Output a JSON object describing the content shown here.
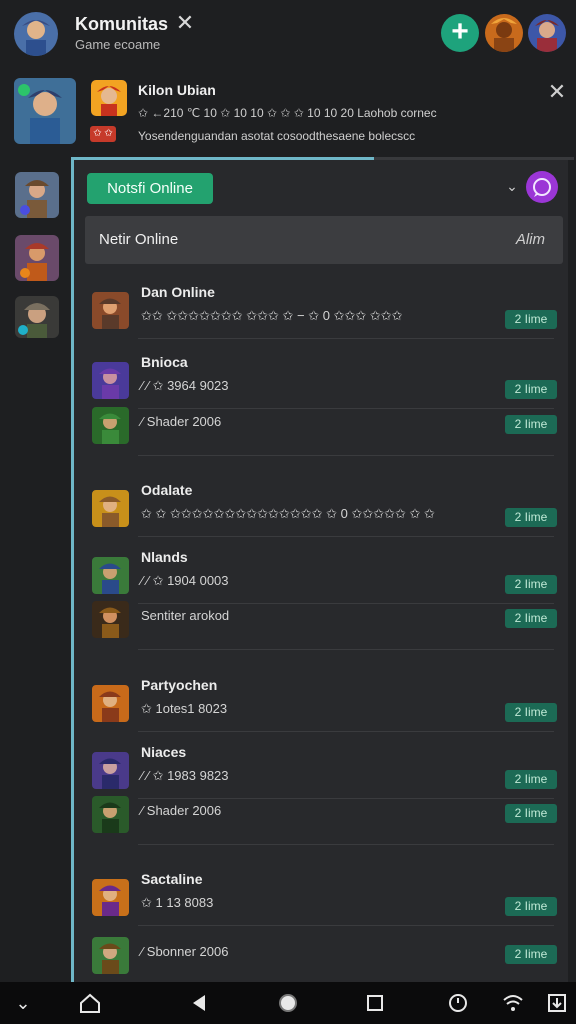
{
  "header": {
    "title": "Komunitas",
    "subtitle": "Game ecoame",
    "close_icon": "close-icon",
    "add_icon": "plus-icon"
  },
  "notification": {
    "title": "Kilon Ubian",
    "line1": "✩ ←210 ℃ 10 ✩ 10 10 ✩ ✩ ✩ 10 10 20 Laohob cornec",
    "line2": "Yosendenguandan asotat cosoodthesaene bolecscc",
    "badge": "✩ ✩"
  },
  "panel": {
    "status_button": "Notsfi Online",
    "subheader_title": "Netir Online",
    "subheader_right": "Alim",
    "rows": [
      {
        "name": "Dan Online",
        "detail": "✩✩ ✩✩✩✩✩✩✩ ✩✩✩ ✩ − ✩ 0 ✩✩✩ ✩✩✩",
        "badge": "2 Iime"
      },
      {
        "name": "Bnioca",
        "detail": "⁄ ⁄ ✩ 3964 9023",
        "badge": "2 Iime"
      },
      {
        "name": "",
        "detail": "⁄ Shader 2006",
        "badge": "2 Iime"
      },
      {
        "name": "Odalate",
        "detail": "✩ ✩ ✩✩✩✩✩✩✩✩✩✩✩✩✩✩ ✩ 0 ✩✩✩✩✩ ✩ ✩",
        "badge": "2 Iime"
      },
      {
        "name": "Nlands",
        "detail": "⁄ ⁄ ✩ 1904 0003",
        "badge": "2 Iime"
      },
      {
        "name": "",
        "detail": "Sentiter arokod",
        "badge": "2 Iime"
      },
      {
        "name": "Partyochen",
        "detail": "✩ 1otes1 8023",
        "badge": "2 Iime"
      },
      {
        "name": "Niaces",
        "detail": "⁄ ⁄ ✩ 1983 9823",
        "badge": "2 Iime"
      },
      {
        "name": "",
        "detail": "⁄ Shader 2006",
        "badge": "2 Iime"
      },
      {
        "name": "Sactaline",
        "detail": "✩ 1 13 8083",
        "badge": "2 Iime"
      },
      {
        "name": "",
        "detail": "⁄ Sbonner 2006",
        "badge": "2 Iime"
      }
    ]
  },
  "icons": [
    "plus-icon",
    "close-icon",
    "chevron-down-icon",
    "chat-icon",
    "back-icon",
    "home-icon",
    "recents-icon"
  ],
  "colors": {
    "accent": "#23a26f",
    "panel_border": "#6fb7c8",
    "chat": "#9b36d6",
    "badge": "#1c6a55"
  }
}
